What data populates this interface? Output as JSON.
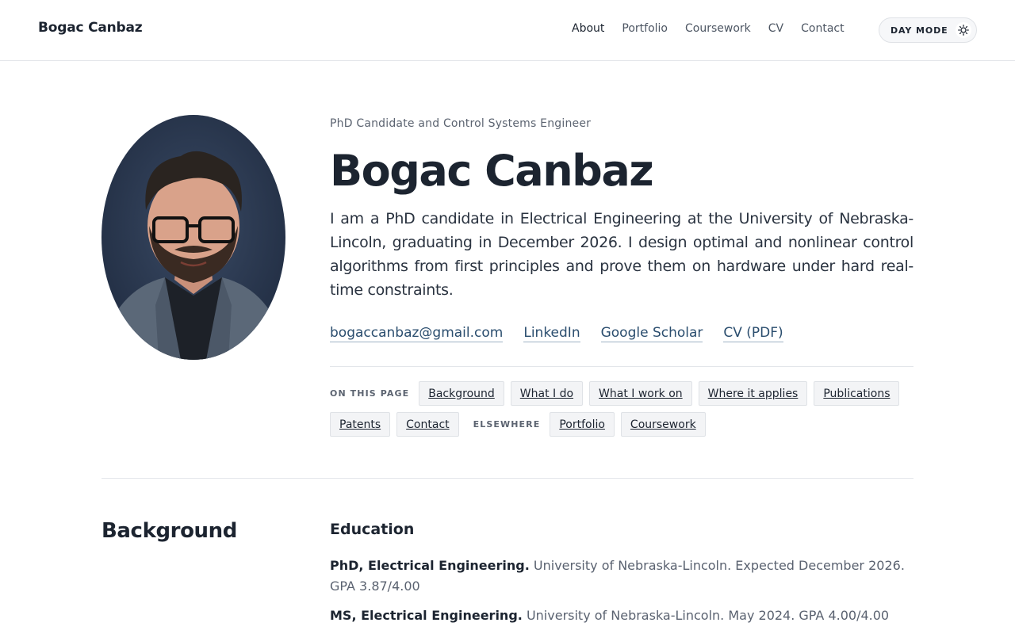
{
  "header": {
    "brand": "Bogac Canbaz",
    "nav": [
      "About",
      "Portfolio",
      "Coursework",
      "CV",
      "Contact"
    ],
    "active_nav": "About",
    "mode_toggle_label": "DAY MODE",
    "mode_icon": "sun-icon"
  },
  "hero": {
    "eyebrow": "PhD Candidate and Control Systems Engineer",
    "name": "Bogac Canbaz",
    "intro": "I am a PhD candidate in Electrical Engineering at the University of Nebraska-Lincoln, graduating in December 2026. I design optimal and nonlinear control algorithms from first principles and prove them on hardware under hard real-time constraints.",
    "links": [
      "bogaccanbaz@gmail.com",
      "LinkedIn",
      "Google Scholar",
      "CV (PDF)"
    ],
    "on_this_page_label": "ON THIS PAGE",
    "on_this_page": [
      "Background",
      "What I do",
      "What I work on",
      "Where it applies",
      "Publications",
      "Patents",
      "Contact"
    ],
    "elsewhere_label": "ELSEWHERE",
    "elsewhere": [
      "Portfolio",
      "Coursework"
    ]
  },
  "background": {
    "title": "Background",
    "education_title": "Education",
    "education": [
      {
        "degree": "PhD, Electrical Engineering.",
        "detail": "University of Nebraska-Lincoln. Expected December 2026. GPA 3.87/4.00"
      },
      {
        "degree": "MS, Electrical Engineering.",
        "detail": "University of Nebraska-Lincoln. May 2024. GPA 4.00/4.00"
      }
    ]
  },
  "colors": {
    "text": "#1c2430",
    "muted": "#5c6471",
    "link": "#2a4d6e",
    "chip_bg": "#f3f4f6",
    "portrait_bg": "#2b3a52"
  }
}
